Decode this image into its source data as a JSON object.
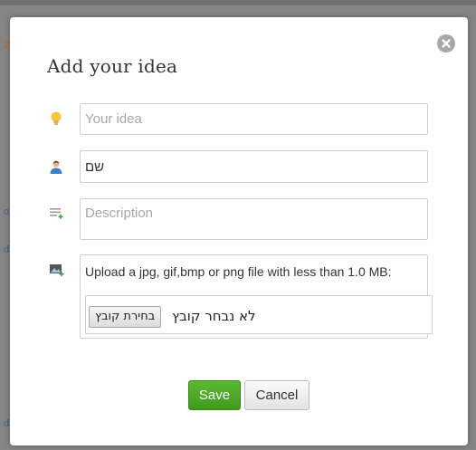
{
  "dialog": {
    "title": "Add your idea",
    "close_icon": "close-circle-icon"
  },
  "fields": {
    "idea": {
      "icon": "lightbulb-icon",
      "value": "",
      "placeholder": "Your idea"
    },
    "name": {
      "icon": "user-icon",
      "value": "שם",
      "placeholder": ""
    },
    "description": {
      "icon": "add-list-icon",
      "value": "",
      "placeholder": "Description"
    }
  },
  "upload": {
    "icon": "add-image-icon",
    "label": "Upload a jpg, gif,bmp or png file with less than 1.0 MB:",
    "button_label": "בחירת קובץ",
    "status": "לא נבחר קובץ"
  },
  "actions": {
    "save_label": "Save",
    "cancel_label": "Cancel"
  },
  "colors": {
    "save_button": "#4caf28",
    "lightbulb": "#f5c33b",
    "user_icon": "#3d7fc4"
  }
}
